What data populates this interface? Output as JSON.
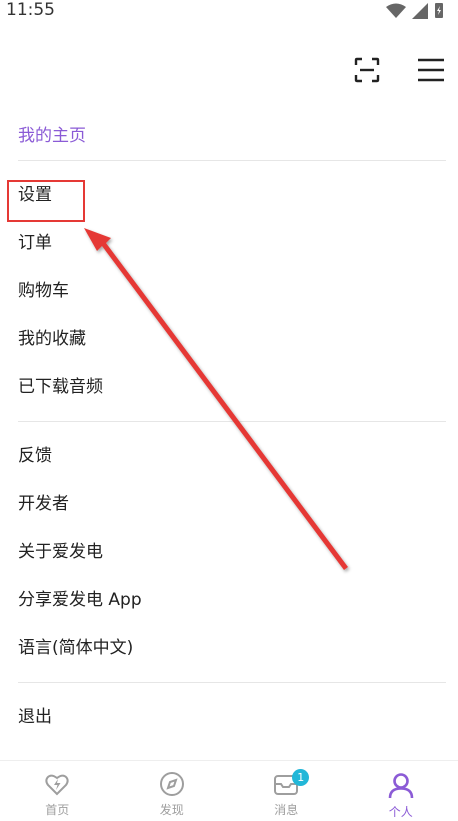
{
  "status_bar": {
    "time": "11:55"
  },
  "header": {
    "scan_icon": "scan-icon",
    "menu_icon": "hamburger-icon"
  },
  "menu": {
    "home_link": "我的主页",
    "group1": [
      "设置",
      "订单",
      "购物车",
      "我的收藏",
      "已下载音频"
    ],
    "group2": [
      "反馈",
      "开发者",
      "关于爱发电",
      "分享爱发电 App",
      "语言(简体中文)"
    ],
    "logout": "退出"
  },
  "tabs": [
    {
      "label": "首页",
      "icon": "lightning-heart-icon"
    },
    {
      "label": "发现",
      "icon": "compass-icon"
    },
    {
      "label": "消息",
      "icon": "message-icon",
      "badge": "1"
    },
    {
      "label": "个人",
      "icon": "person-icon",
      "active": true
    }
  ],
  "colors": {
    "accent": "#8b5bd6",
    "annotation": "#e53935",
    "badge": "#22b7d8"
  }
}
